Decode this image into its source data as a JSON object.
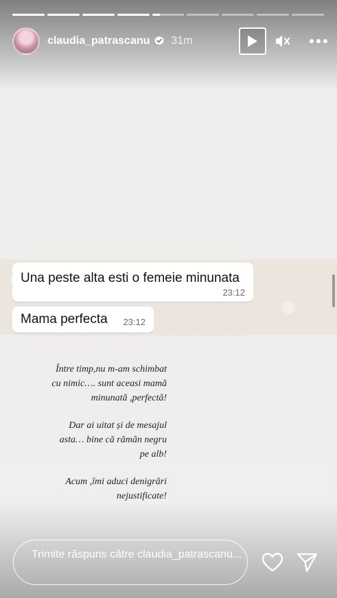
{
  "story": {
    "progress_segments": 9,
    "progress_completed": 4,
    "progress_current_fraction": 0.25
  },
  "header": {
    "username": "claudia_patrascanu",
    "time_ago": "31m",
    "verified": true,
    "actions": {
      "play_icon": "play-icon",
      "mute_icon": "mute-icon",
      "more_icon": "more-icon"
    }
  },
  "chat": {
    "messages": [
      {
        "text": "Una peste alta esti o femeie minunata",
        "time": "23:12"
      },
      {
        "text": "Mama perfecta",
        "time": "23:12"
      }
    ]
  },
  "note": {
    "paragraphs": [
      [
        "Între timp,nu m-am schimbat",
        "cu nimic…. sunt aceasi mamă",
        "minunată ,perfectă!"
      ],
      [
        "Dar  ai uitat și de mesajul",
        "asta… bine că rămân negru",
        "pe alb!"
      ],
      [
        "Acum ,îmi aduci denigrări",
        "nejustificate!"
      ]
    ]
  },
  "footer": {
    "reply_placeholder": "Trimite răspuns către claudia_patrascanu...",
    "heart_icon": "heart-icon",
    "send_icon": "send-icon"
  },
  "colors": {
    "chat_background": "#ece5dd",
    "bubble": "#ffffff",
    "timestamp": "#6b6b6b"
  }
}
